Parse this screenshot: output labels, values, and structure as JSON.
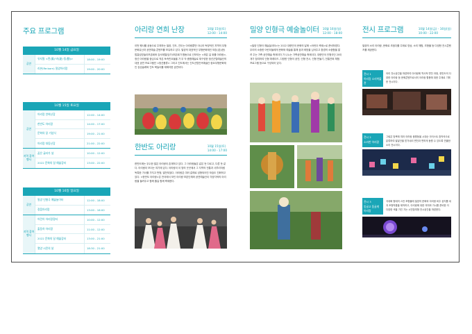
{
  "col1": {
    "title": "주요 프로그램",
    "tables": [
      {
        "header": "10월 14일 금요일",
        "groups": [
          {
            "cat": "공연",
            "rows": [
              {
                "name": "유지필 <먼(風)·바(波)·동(動)>",
                "time": "18:00 - 19:00"
              },
              {
                "name": "리본(Re:born) 밀양아리랑",
                "time": "19:00 - 20:00"
              }
            ]
          }
        ]
      },
      {
        "header": "10월 15일 토요일",
        "groups": [
          {
            "cat": "공연",
            "rows": [
              {
                "name": "아리랑 연희난장",
                "time": "12:00 - 14:00"
              },
              {
                "name": "한반도 아리랑",
                "time": "14:00 - 17:00"
              },
              {
                "name": "문화의 달 기념식",
                "time": "19:00 - 21:00"
              },
              {
                "name": "아리랑 대동난장",
                "time": "21:00 - 22:00"
              }
            ]
          },
          {
            "cat": "지역 참여 행사",
            "rows": [
              {
                "name": "꿈은 굴러가 널",
                "time": "10:00 - 12:00"
              },
              {
                "name": "2022 문화의 달 예술장터",
                "time": "13:00 - 22:00"
              }
            ]
          }
        ]
      },
      {
        "header": "10월 16일 일요일",
        "groups": [
          {
            "cat": "공연",
            "rows": [
              {
                "name": "밀양 인형극 예술놀이터",
                "time": "12:00 - 18:00"
              },
              {
                "name": "정읍아리랑",
                "time": "13:00 - 16:00"
              }
            ]
          },
          {
            "cat": "지역 참여 행사",
            "rows": [
              {
                "name": "어린이 아리랑정터",
                "time": "10:00 - 12:00"
              },
              {
                "name": "출동하 아리랑",
                "time": "11:00 - 12:00"
              },
              {
                "name": "2022 문화의 달 예술장터",
                "time": "13:00 - 21:00"
              },
              {
                "name": "열양 시민의 날",
                "time": "18:30 - 21:00"
              }
            ]
          }
        ]
      }
    ]
  },
  "col2": {
    "title1": "아리랑 연희 난장",
    "sched1_date": "10월 15일(토)",
    "sched1_time": "12:00 - 14:00",
    "text1": "이번 행사를 공동으로 주최하는 밀양, 진도, 진도는 아리랑뿐만 아니라 독창적인 지역의 무형문화유산과 공연예술 콘텐츠를 보유하고 있다. 밀양의 대표적인 무형문화재인 보존(法)(한) 법흥성받솔이보존회와 강서제철(당가)보존회가 함동으로 선보이는 <뭐은 길 위를 아리랑>, 정선 아리랑을 중심으로 작은 토속민요들을 가 무 악 종합예술로 재구성한 정선군립예술단의 대표 공연 프로그램인 <정선풍류> 그리고 진도에서는 진도군립민속예술단 중요무형문화재인 강강술래와 진도 북놀이를 재해석한 공연이다.",
    "title2": "한반도 아리랑",
    "sched2_date": "10월 15일(토)",
    "sched2_time": "14:00 - 17:00",
    "text2": "한반도에는 우수한 많은 아리랑이 존재하고 있다. 그 아리랑들은 같은 듯 다르고, 다른 듯 같다. 아리랑이 모이는 여기에 있다. 아리랑이 이 땅의 곳곳에서 그 지역의 전통과 사투리처럼 독특한 가사를 가지고 번형, 발전되었다. 아리랑은 여러 갈래로 성형되어진 모습도 진화하고 있다. <한반도 아리랑>은 전국에서 모인 아리랑 보존단체와 공연예술단이 각양각색의 아리랑을 들려주고 함께 즐길 함께 축제한다."
  },
  "col3": {
    "title": "밀양 인형극 예술놀이터",
    "sched_date": "10월 16일(일)",
    "sched_time": "12:00 - 18:00",
    "text": "<밀양 인형극 예술놀이터>는 2022 대한민국 문화의 달에 <어린이 축제>로 준비하였다. 우리의 소중한 어린이들에게 문화와 예술을 통해 꿈과 희망을 심어주고 환경의 소중함을 알려 주는 가족 공연예술 축제이자 가 나누는 가족공연예술 축제이다. 대한민국 인형극단 20이 개가 참여하여 인형 퍼레이드, 다양한 인형극 공연, 인형 전시, 인형 만들기, 전통연희 체험 프로그램 등으로 구성되어 있다."
  },
  "col4": {
    "title": "전시 프로그램",
    "sched_date": "10월 14일(금) - 16일(일)",
    "sched_time": "10:00 - 22:00",
    "intro": "밀양의 소리 아리랑, 문화로 초점다를 주제로 영상, 소리 체험, 조형물 등 다양한 전시콘텐츠를 제공한다.",
    "items": [
      {
        "tag": "전시 1",
        "label": "아리랑 소리박물관",
        "text": "아리 전시공간을 마련하여 아리랑에 역사적 변천 과정, 한반도의 다양한 아리랑 등 문화콘텐츠로서의 아리랑 활용에 대한 주제로 기획한 전시이다."
      },
      {
        "tag": "전시 2",
        "label": "소리한 아리랑",
        "text": "그림은 방목에 여러 아리랑 음원등을 시대순 아이스트 참작곡으로 분류하여 발달단을 받가네리 변천과 변하게 동원 수 있도록 연출한 소리 전시이다."
      },
      {
        "tag": "전시 3",
        "label": "동글고 동글게 아리랑",
        "text": "극대화 형태의 스탄 조형물에 밀양의 문화와 아리랑 비주 공지를 세겨 조형작품을 제작하고, 아리랑에 대한 의미와 가시를 준비한 이 다양한 색을 가진 가는 시민참여형 전시공간을 마련한다."
      }
    ]
  }
}
